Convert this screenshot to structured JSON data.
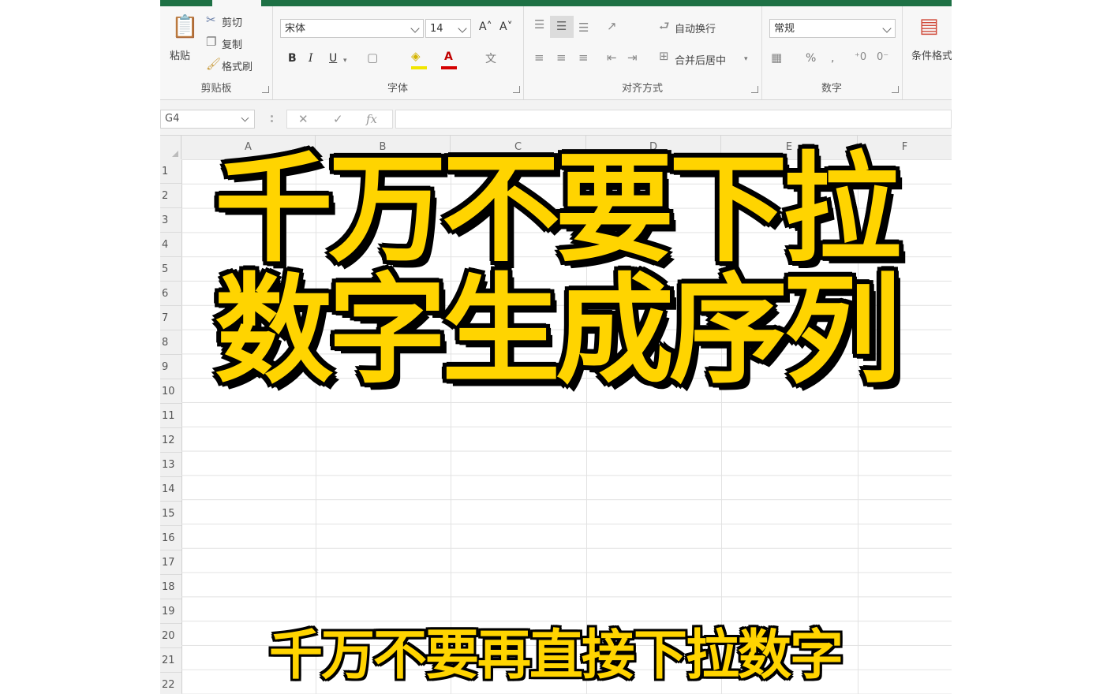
{
  "ribbon": {
    "clipboard": {
      "paste": "粘贴",
      "cut": "剪切",
      "copy": "复制",
      "format_painter": "格式刷",
      "label": "剪贴板"
    },
    "font": {
      "font_name": "宋体",
      "font_size": "14",
      "bold": "B",
      "italic": "I",
      "underline": "U",
      "grow": "A˄",
      "shrink": "A˅",
      "font_color_glyph": "A",
      "phonetic": "文",
      "label": "字体"
    },
    "alignment": {
      "wrap_text": "自动换行",
      "merge_center": "合并后居中",
      "label": "对齐方式"
    },
    "number": {
      "format": "常规",
      "percent": "%",
      "comma": ",",
      "label": "数字"
    },
    "styles": {
      "conditional_formatting": "条件格式"
    }
  },
  "formula_bar": {
    "name_box": "G4",
    "cancel": "✕",
    "enter": "✓",
    "fx": "fx",
    "content": ""
  },
  "grid": {
    "columns": [
      "A",
      "B",
      "C",
      "D",
      "E",
      "F"
    ],
    "rows": [
      "1",
      "2",
      "3",
      "4",
      "5",
      "6",
      "7",
      "8",
      "9",
      "10",
      "11",
      "12",
      "13",
      "14",
      "15",
      "16",
      "17",
      "18",
      "19",
      "20",
      "21",
      "22"
    ]
  },
  "overlay": {
    "headline_line1": "千万不要下拉",
    "headline_line2": "数字生成序列",
    "subtitle": "千万不要再直接下拉数字"
  },
  "colors": {
    "caption_fill": "#ffd400",
    "caption_outline": "#000000",
    "excel_green": "#1e7145"
  }
}
